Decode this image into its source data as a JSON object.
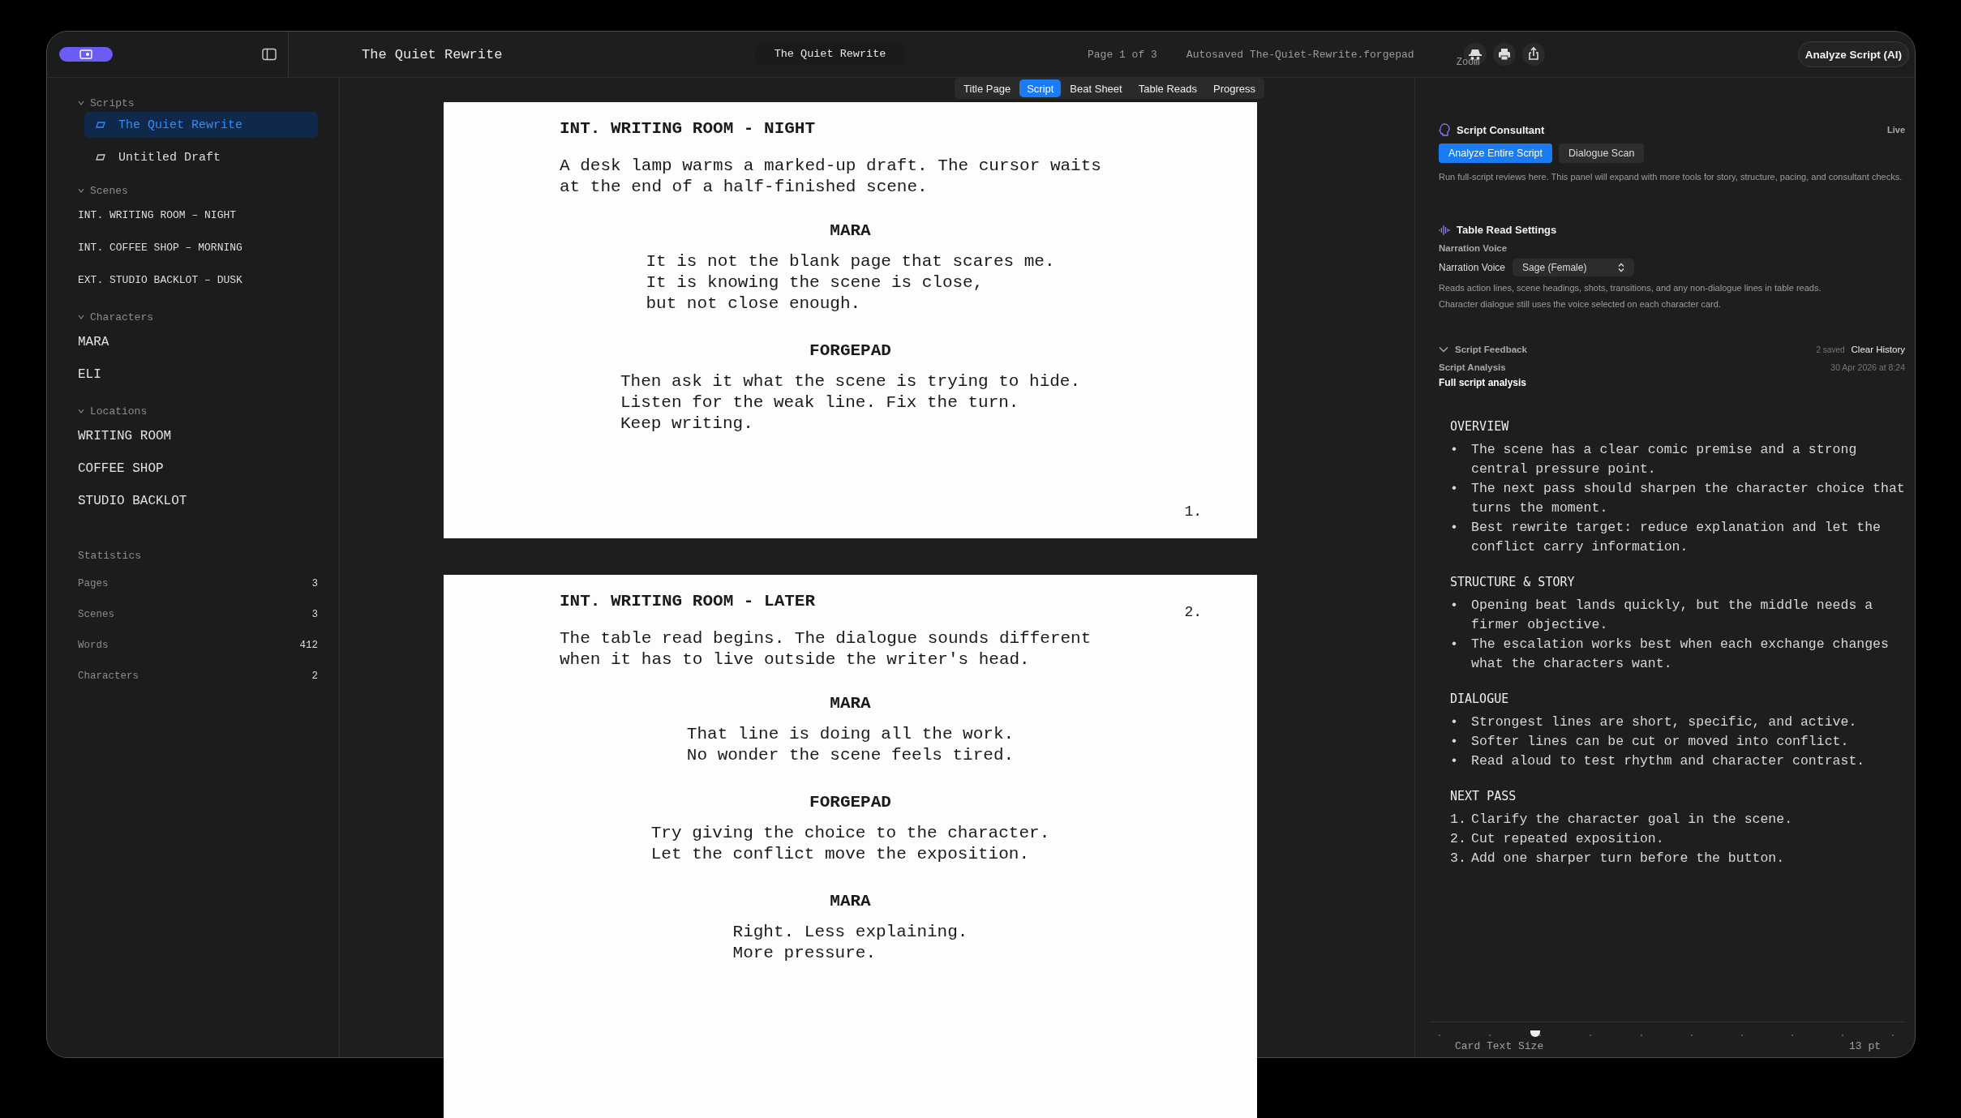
{
  "toolbar": {
    "sidebar_title": "The Quiet Rewrite",
    "document_pill": "The Quiet Rewrite",
    "page_status": "Page 1 of 3",
    "autosave": "Autosaved The-Quiet-Rewrite.forgepad",
    "zoom_label": "Zoom",
    "analyze_button": "Analyze Script (AI)"
  },
  "tabs": [
    {
      "label": "Title Page",
      "selected": false
    },
    {
      "label": "Script",
      "selected": true
    },
    {
      "label": "Beat Sheet",
      "selected": false
    },
    {
      "label": "Table Reads",
      "selected": false
    },
    {
      "label": "Progress",
      "selected": false
    }
  ],
  "sidebar": {
    "sections": [
      {
        "title": "Scripts",
        "kind": "scripts",
        "items": [
          {
            "label": "The Quiet Rewrite",
            "selected": true
          },
          {
            "label": "Untitled Draft",
            "selected": false
          }
        ]
      },
      {
        "title": "Scenes",
        "kind": "scenes",
        "items": [
          {
            "label": "INT. WRITING ROOM – NIGHT"
          },
          {
            "label": "INT. COFFEE SHOP – MORNING"
          },
          {
            "label": "EXT. STUDIO BACKLOT – DUSK"
          }
        ]
      },
      {
        "title": "Characters",
        "kind": "names",
        "items": [
          {
            "label": "MARA"
          },
          {
            "label": "ELI"
          }
        ]
      },
      {
        "title": "Locations",
        "kind": "names",
        "items": [
          {
            "label": "WRITING ROOM"
          },
          {
            "label": "COFFEE SHOP"
          },
          {
            "label": "STUDIO BACKLOT"
          }
        ]
      }
    ],
    "statistics": {
      "title": "Statistics",
      "rows": [
        {
          "label": "Pages",
          "value": "3"
        },
        {
          "label": "Scenes",
          "value": "3"
        },
        {
          "label": "Words",
          "value": "412"
        },
        {
          "label": "Characters",
          "value": "2"
        }
      ]
    }
  },
  "script_pages": [
    {
      "number": "1.",
      "elements": [
        {
          "kind": "heading",
          "lines": [
            "INT. WRITING ROOM - NIGHT"
          ]
        },
        {
          "kind": "action",
          "lines": [
            "A desk lamp warms a marked-up draft. The cursor waits",
            "at the end of a half-finished scene."
          ]
        },
        {
          "kind": "character",
          "lines": [
            "MARA"
          ]
        },
        {
          "kind": "dialogue",
          "lines": [
            "It is not the blank page that scares me.",
            "It is knowing the scene is close,",
            "but not close enough."
          ]
        },
        {
          "kind": "character",
          "lines": [
            "FORGEPAD"
          ]
        },
        {
          "kind": "dialogue",
          "lines": [
            "Then ask it what the scene is trying to hide.",
            "Listen for the weak line. Fix the turn.",
            "Keep writing."
          ]
        }
      ]
    },
    {
      "number": "2.",
      "elements": [
        {
          "kind": "heading",
          "lines": [
            "INT. WRITING ROOM - LATER"
          ]
        },
        {
          "kind": "action",
          "lines": [
            "The table read begins. The dialogue sounds different",
            "when it has to live outside the writer's head."
          ]
        },
        {
          "kind": "character",
          "lines": [
            "MARA"
          ]
        },
        {
          "kind": "dialogue",
          "lines": [
            "That line is doing all the work.",
            "No wonder the scene feels tired."
          ]
        },
        {
          "kind": "character",
          "lines": [
            "FORGEPAD"
          ]
        },
        {
          "kind": "dialogue",
          "lines": [
            "Try giving the choice to the character.",
            "Let the conflict move the exposition."
          ]
        },
        {
          "kind": "character",
          "lines": [
            "MARA"
          ]
        },
        {
          "kind": "dialogue",
          "lines": [
            "Right. Less explaining.",
            "More pressure."
          ]
        }
      ]
    }
  ],
  "consultant": {
    "title": "Script Consultant",
    "status": "Live",
    "actions": [
      {
        "label": "Analyze Entire Script",
        "selected": true
      },
      {
        "label": "Dialogue Scan",
        "selected": false
      }
    ],
    "description": "Run full-script reviews here. This panel will expand with more tools for story, structure, pacing, and consultant checks."
  },
  "table_read": {
    "title": "Table Read Settings",
    "section_label": "Narration Voice",
    "field_label": "Narration Voice",
    "voice": "Sage (Female)",
    "notes": [
      "Reads action lines, scene headings, shots, transitions, and any non-dialogue lines in table reads.",
      "Character dialogue still uses the voice selected on each character card."
    ]
  },
  "feedback": {
    "title": "Script Feedback",
    "expanded": true,
    "saved_count": "2 saved",
    "clear_button": "Clear History",
    "entry": {
      "type": "Script Analysis",
      "date": "30 Apr 2026 at 8:24",
      "title": "Full script analysis",
      "sections": [
        {
          "heading": "OVERVIEW",
          "items": [
            {
              "marker": "•",
              "text": "The scene has a clear comic premise and a strong central pressure point."
            },
            {
              "marker": "•",
              "text": "The next pass should sharpen the character choice that turns the moment."
            },
            {
              "marker": "•",
              "text": "Best rewrite target: reduce explanation and let the conflict carry information."
            }
          ]
        },
        {
          "heading": "STRUCTURE & STORY",
          "items": [
            {
              "marker": "•",
              "text": "Opening beat lands quickly, but the middle needs a firmer objective."
            },
            {
              "marker": "•",
              "text": "The escalation works best when each exchange changes what the characters want."
            }
          ]
        },
        {
          "heading": "DIALOGUE",
          "items": [
            {
              "marker": "•",
              "text": "Strongest lines are short, specific, and active."
            },
            {
              "marker": "•",
              "text": "Softer lines can be cut or moved into conflict."
            },
            {
              "marker": "•",
              "text": "Read aloud to test rhythm and character contrast."
            }
          ]
        },
        {
          "heading": "NEXT PASS",
          "items": [
            {
              "marker": "1.",
              "text": "Clarify the character goal in the scene."
            },
            {
              "marker": "2.",
              "text": "Cut repeated exposition."
            },
            {
              "marker": "3.",
              "text": "Add one sharper turn before the button."
            }
          ]
        }
      ]
    }
  },
  "card_text_size": {
    "label": "Card Text Size",
    "value": "13 pt",
    "level": 0.21
  }
}
